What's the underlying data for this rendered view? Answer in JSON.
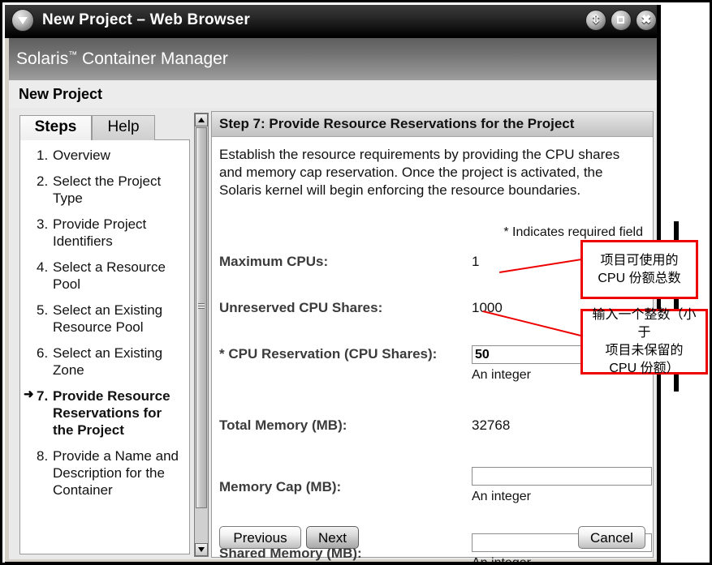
{
  "window": {
    "title": "New Project – Web Browser",
    "menu_icon": "triangle-down-icon",
    "buttons": {
      "shade": "shade-window",
      "maximize": "maximize-window",
      "close": "close-window"
    }
  },
  "banner": {
    "product": "Solaris",
    "trademark": "™",
    "product_suffix": " Container Manager"
  },
  "page_header": {
    "title": "New Project"
  },
  "sidebar": {
    "tabs": [
      {
        "label": "Steps",
        "active": true
      },
      {
        "label": "Help",
        "active": false
      }
    ],
    "steps": [
      {
        "num": "1.",
        "label": "Overview",
        "current": false
      },
      {
        "num": "2.",
        "label": "Select the Project Type",
        "current": false
      },
      {
        "num": "3.",
        "label": "Provide Project Identifiers",
        "current": false
      },
      {
        "num": "4.",
        "label": "Select a Resource Pool",
        "current": false
      },
      {
        "num": "5.",
        "label": "Select an Existing Resource Pool",
        "current": false
      },
      {
        "num": "6.",
        "label": "Select an Existing Zone",
        "current": false
      },
      {
        "num": "7.",
        "label": "Provide Resource Reservations for the Project",
        "current": true
      },
      {
        "num": "8.",
        "label": "Provide a Name and Description for the Container",
        "current": false
      }
    ],
    "current_marker": "➜"
  },
  "content": {
    "step_title": "Step 7:  Provide Resource Reservations for the Project",
    "description": "Establish the resource requirements by providing the CPU shares and memory cap reservation. Once the project is activated, the Solaris kernel will begin enforcing the resource boundaries.",
    "required_note": "* Indicates required field",
    "fields": {
      "maximum_cpus": {
        "label": "Maximum CPUs:",
        "value": "1"
      },
      "unreserved_cpu_shares": {
        "label": "Unreserved CPU Shares:",
        "value": "1000"
      },
      "cpu_reservation": {
        "label": "* CPU Reservation (CPU Shares):",
        "value": "50",
        "hint": "An integer"
      },
      "total_memory": {
        "label": "Total Memory (MB):",
        "value": "32768"
      },
      "memory_cap": {
        "label": "Memory Cap (MB):",
        "value": "",
        "hint": "An integer"
      },
      "shared_memory": {
        "label": "Shared Memory (MB):",
        "value": "",
        "hint": "An integer"
      }
    },
    "buttons": {
      "previous": "Previous",
      "next": "Next",
      "cancel": "Cancel"
    }
  },
  "annotations": [
    {
      "text": "项目可使用的\nCPU 份额总数",
      "lines": [
        "项目可使用的",
        "CPU 份额总数"
      ]
    },
    {
      "text": "输入一个整数（小于项目未保留的CPU 份额）",
      "lines": [
        "输入一个整数（小于",
        "项目未保留的",
        "CPU 份额）"
      ]
    }
  ],
  "colors": {
    "annotation_border": "#ee0000",
    "titlebar": "#111111",
    "banner": "#7a7a7a"
  },
  "scrollbar": {
    "up_icon": "triangle-up-icon",
    "down_icon": "triangle-down-icon"
  }
}
